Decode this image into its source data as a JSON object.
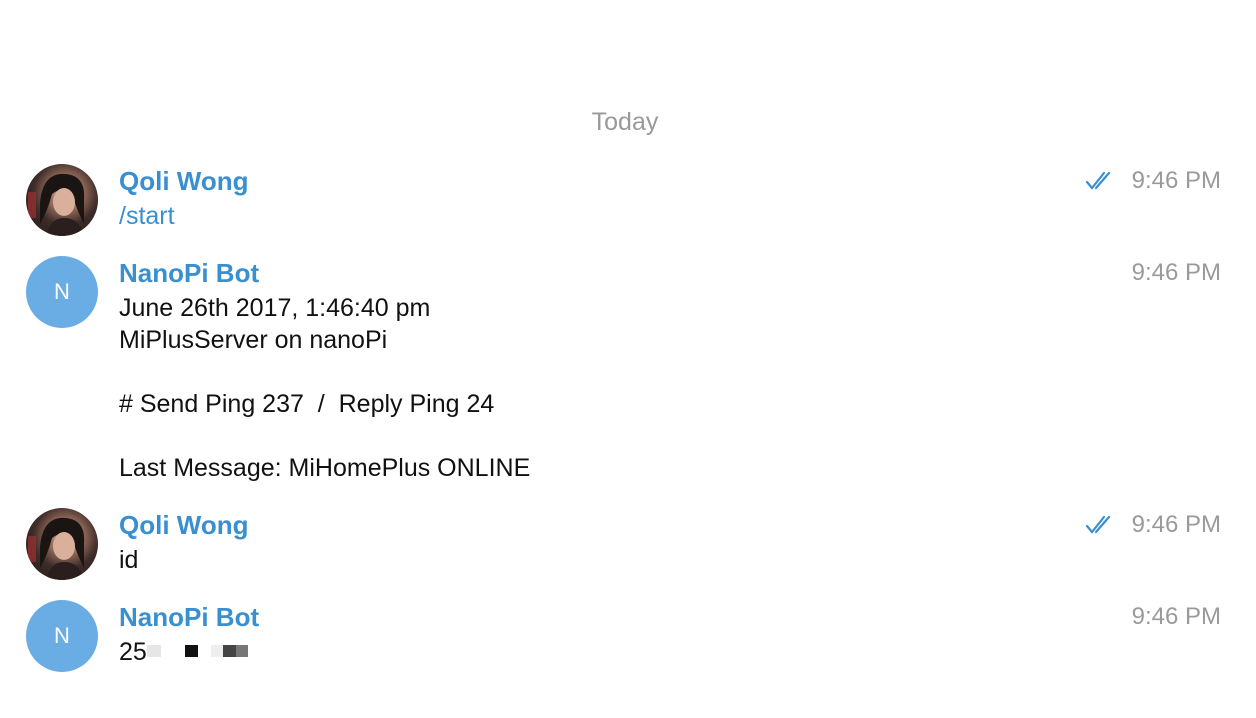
{
  "date_separator": "Today",
  "colors": {
    "accent": "#3a8fd0",
    "bot_avatar": "#6aade4",
    "timestamp": "#9a9a9a",
    "text": "#111111"
  },
  "messages": [
    {
      "sender": "Qoli Wong",
      "avatar": "photo",
      "text": "/start",
      "is_command": true,
      "time": "9:46 PM",
      "read_receipt": "double-check-icon"
    },
    {
      "sender": "NanoPi Bot",
      "avatar_letter": "N",
      "text": "June 26th 2017, 1:46:40 pm\nMiPlusServer on nanoPi\n\n# Send Ping 237  /  Reply Ping 24\n\nLast Message: MiHomePlus ONLINE",
      "time": "9:46 PM"
    },
    {
      "sender": "Qoli Wong",
      "avatar": "photo",
      "text": "id",
      "time": "9:46 PM",
      "read_receipt": "double-check-icon"
    },
    {
      "sender": "NanoPi Bot",
      "avatar_letter": "N",
      "text": "25",
      "redacted_suffix": true,
      "time": "9:46 PM"
    }
  ]
}
